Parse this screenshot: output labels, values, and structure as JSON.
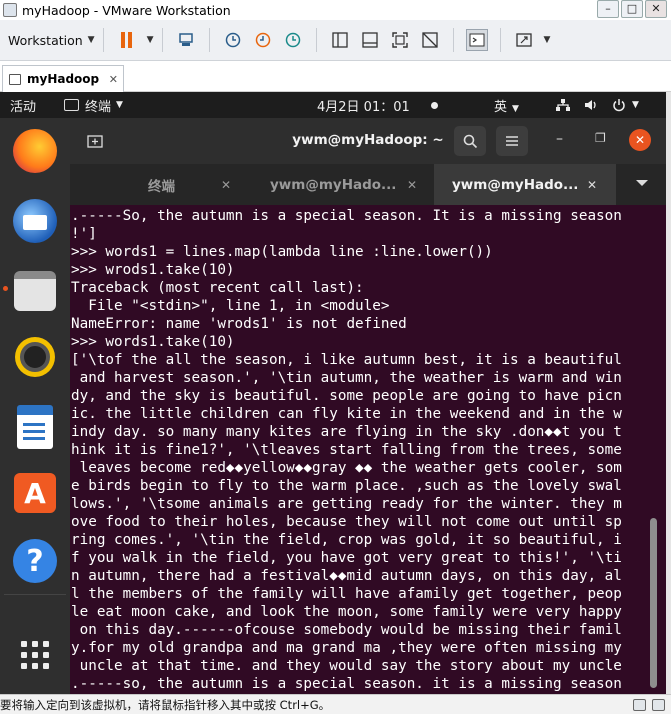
{
  "vmware": {
    "title": "myHadoop - VMware Workstation",
    "window_buttons": {
      "minimize": "–",
      "maximize": "□",
      "close": "✕"
    },
    "toolbar": {
      "workstation_menu": "Workstation"
    },
    "tab": {
      "label": "myHadoop",
      "close": "✕"
    },
    "status_text": "要将输入定向到该虚拟机，请将鼠标指针移入其中或按 Ctrl+G。"
  },
  "gnome": {
    "activities": "活动",
    "app_menu": "终端",
    "clock": "4月2日  01：01",
    "input_method": "英"
  },
  "terminal": {
    "title": "ywm@myHadoop: ~",
    "tabs": [
      {
        "label": "终端",
        "active": false
      },
      {
        "label": "ywm@myHado...",
        "active": false
      },
      {
        "label": "ywm@myHado...",
        "active": true
      }
    ],
    "tab_close": "✕",
    "lines": [
      ".-----So, the autumn is a special season. It is a missing season",
      "!']",
      ">>> words1 = lines.map(lambda line :line.lower())",
      ">>> wrods1.take(10)",
      "Traceback (most recent call last):",
      "  File \"<stdin>\", line 1, in <module>",
      "NameError: name 'wrods1' is not defined",
      ">>> words1.take(10)",
      "['\\tof the all the season, i like autumn best, it is a beautiful",
      " and harvest season.', '\\tin autumn, the weather is warm and win",
      "dy, and the sky is beautiful. some people are going to have picn",
      "ic. the little children can fly kite in the weekend and in the w",
      "indy day. so many many kites are flying in the sky .don◆◆t you t",
      "hink it is fine1?', '\\tleaves start falling from the trees, some",
      " leaves become red◆◆yellow◆◆gray ◆◆ the weather gets cooler, som",
      "e birds begin to fly to the warm place. ,such as the lovely swal",
      "lows.', '\\tsome animals are getting ready for the winter. they m",
      "ove food to their holes, because they will not come out until sp",
      "ring comes.', '\\tin the field, crop was gold, it so beautiful, i",
      "f you walk in the field, you have got very great to this!', '\\ti",
      "n autumn, there had a festival◆◆mid autumn days, on this day, al",
      "l the members of the family will have afamily get together, peop",
      "le eat moon cake, and look the moon, some family were very happy",
      " on this day.------ofcouse somebody would be missing their famil",
      "y.for my old grandpa and ma grand ma ,they were often missing my",
      " uncle at that time. and they would say the story about my uncle",
      ".-----so, the autumn is a special season. it is a missing season"
    ]
  },
  "colors": {
    "terminal_bg": "#300a24",
    "ubuntu_accent": "#e95420",
    "dock_bg": "#2f2f2f"
  },
  "icons": {
    "dock": [
      "firefox-icon",
      "thunderbird-icon",
      "files-icon",
      "rhythmbox-icon",
      "libreoffice-writer-icon",
      "ubuntu-software-icon",
      "help-icon",
      "show-applications-icon"
    ]
  }
}
